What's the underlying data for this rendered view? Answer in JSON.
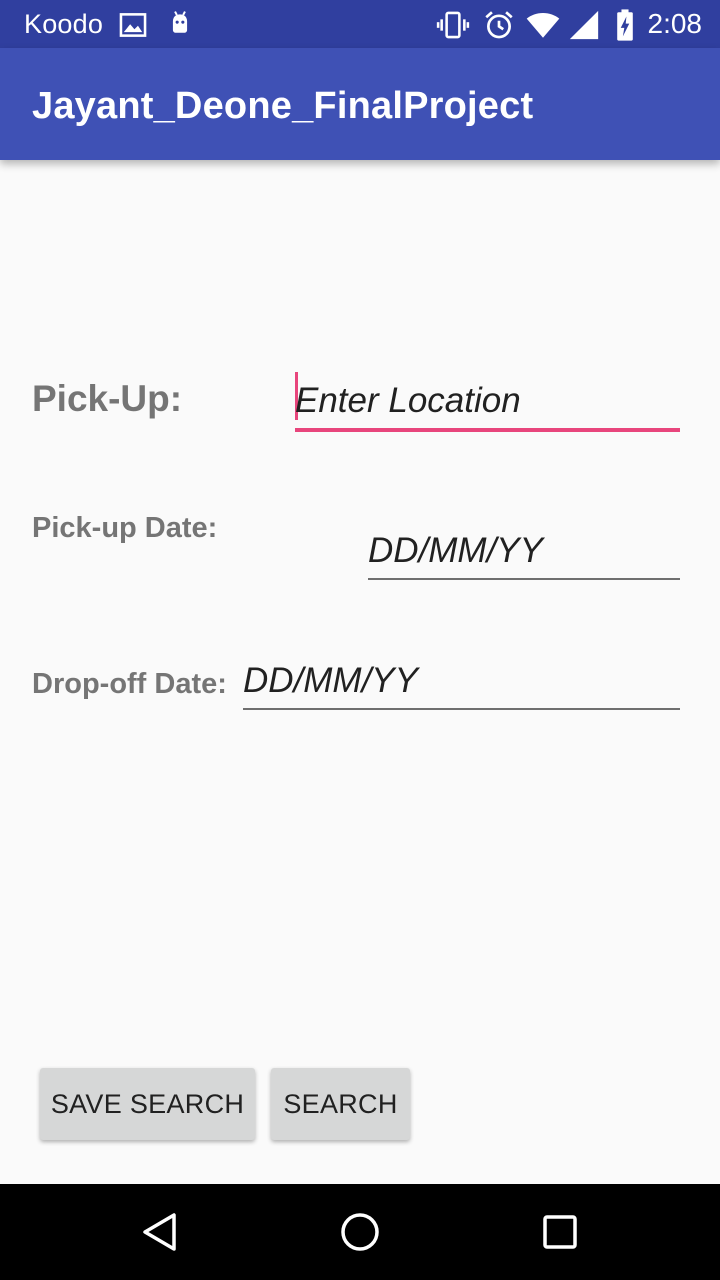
{
  "status_bar": {
    "carrier": "Koodo",
    "time": "2:08",
    "icons": [
      "image-notification-icon",
      "android-notification-icon",
      "vibrate-icon",
      "alarm-icon",
      "wifi-icon",
      "cell-signal-icon",
      "battery-charging-icon"
    ]
  },
  "app_bar": {
    "title": "Jayant_Deone_FinalProject"
  },
  "form": {
    "pickup_label": "Pick-Up:",
    "location_placeholder": "Enter Location",
    "pickup_date_label": "Pick-up Date:",
    "pickup_date_placeholder": "DD/MM/YY",
    "dropoff_date_label": "Drop-off Date:",
    "dropoff_date_placeholder": "DD/MM/YY"
  },
  "buttons": {
    "save_search": "SAVE SEARCH",
    "search": "SEARCH"
  },
  "nav_bar": {
    "icons": [
      "back-icon",
      "home-icon",
      "recents-icon"
    ]
  },
  "colors": {
    "status_bar": "#303f9f",
    "app_bar": "#3f51b5",
    "accent": "#e8457c",
    "background": "#fafafa",
    "label_text": "#757575",
    "button_bg": "#d6d7d7"
  }
}
